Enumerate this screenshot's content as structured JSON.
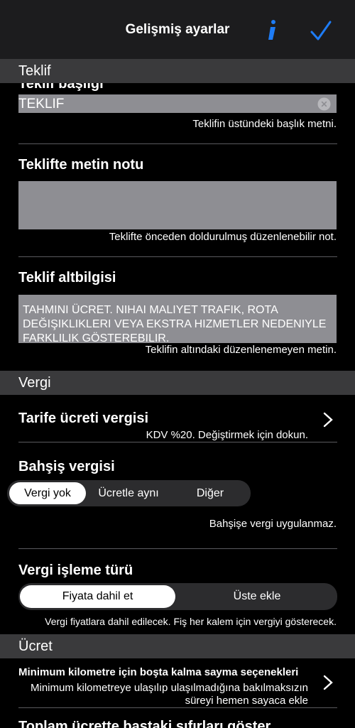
{
  "nav": {
    "title": "Gelişmiş ayarlar"
  },
  "sections": {
    "teklif": "Teklif",
    "vergi": "Vergi",
    "ucret": "Ücret"
  },
  "teklif_basligi": {
    "label": "Teklif başlığı",
    "value": "TEKLIF",
    "caption": "Teklifin üstündeki başlık metni."
  },
  "metin_notu": {
    "label": "Teklifte metin notu",
    "value": "",
    "caption": "Teklifte önceden doldurulmuş düzenlenebilir not."
  },
  "altbilgi": {
    "label": "Teklif altbilgisi",
    "value": "TAHMINI ÜCRET. NIHAI MALIYET TRAFIK, ROTA DEĞIŞIKLIKLERI VEYA EKSTRA HIZMETLER NEDENIYLE FARKLILIK GÖSTEREBILIR.",
    "caption": "Teklifin altındaki düzenlenemeyen metin."
  },
  "tarife_vergisi": {
    "label": "Tarife ücreti vergisi",
    "caption": "KDV %20. Değiştirmek için dokun."
  },
  "bahsis_vergisi": {
    "label": "Bahşiş vergisi",
    "options": [
      "Vergi yok",
      "Ücretle aynı",
      "Diğer"
    ],
    "selected": "Vergi yok",
    "caption": "Bahşişe vergi uygulanmaz."
  },
  "vergi_isleme": {
    "label": "Vergi işleme türü",
    "options": [
      "Fiyata dahil et",
      "Üste ekle"
    ],
    "selected": "Fiyata dahil et",
    "caption": "Vergi fiyatlara dahil edilecek. Fiş her kalem için vergiyi gösterecek."
  },
  "min_km": {
    "label": "Minimum kilometre için boşta kalma sayma seçenekleri",
    "caption_line1": "Minimum kilometreye ulaşılıp ulaşılmadığına bakılmaksızın",
    "caption_line2": "süreyi hemen sayaca ekle"
  },
  "toplam": {
    "label": "Toplam ücrette baştaki sıfırları göster"
  },
  "colors": {
    "accent": "#1e7cf5",
    "field": "#8e8e93",
    "section": "#3a3a3c"
  }
}
